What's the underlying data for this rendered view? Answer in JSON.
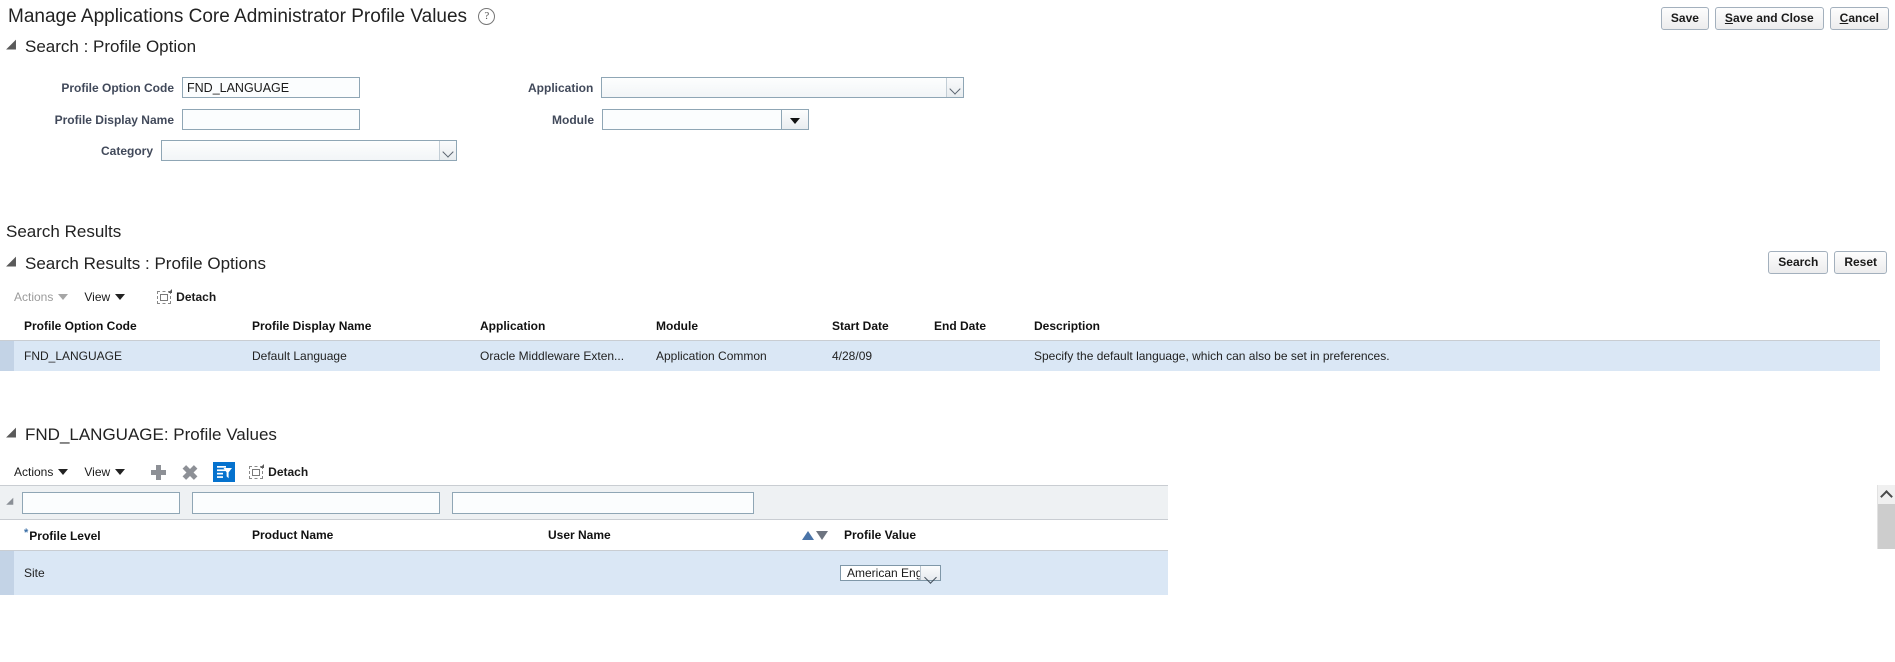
{
  "page": {
    "title": "Manage Applications Core Administrator Profile Values",
    "help_icon": "help-icon"
  },
  "header_buttons": {
    "save": "Save",
    "save_and_close_pre": "S",
    "save_and_close_rest": "ave and Close",
    "cancel_pre": "C",
    "cancel_rest": "ancel"
  },
  "search_section": {
    "title": "Search : Profile Option",
    "fields": {
      "profile_option_code": {
        "label": "Profile Option Code",
        "value": "FND_LANGUAGE"
      },
      "profile_display_name": {
        "label": "Profile Display Name",
        "value": ""
      },
      "category": {
        "label": "Category",
        "value": ""
      },
      "application": {
        "label": "Application",
        "value": ""
      },
      "module": {
        "label": "Module",
        "value": ""
      }
    },
    "buttons": {
      "search": "Search",
      "reset": "Reset"
    }
  },
  "search_results": {
    "plain_heading": "Search Results",
    "section_title": "Search Results : Profile Options",
    "toolbar": {
      "actions": "Actions",
      "view": "View",
      "detach": "Detach"
    },
    "columns": [
      "Profile Option Code",
      "Profile Display Name",
      "Application",
      "Module",
      "Start Date",
      "End Date",
      "Description"
    ],
    "rows": [
      {
        "profile_option_code": "FND_LANGUAGE",
        "profile_display_name": "Default Language",
        "application": "Oracle Middleware Exten...",
        "module": "Application Common",
        "start_date": "4/28/09",
        "end_date": "",
        "description": "Specify the default language, which can also be set in preferences."
      }
    ]
  },
  "profile_values": {
    "section_title": "FND_LANGUAGE: Profile Values",
    "toolbar": {
      "actions": "Actions",
      "view": "View",
      "add": "add-row-icon",
      "delete": "delete-row-icon",
      "query_by_example": "query-by-example-icon",
      "detach": "Detach"
    },
    "filter_row": {
      "profile_level_filter": "",
      "product_name_filter": "",
      "user_name_filter": ""
    },
    "columns": [
      {
        "label": "Profile Level",
        "required": true
      },
      {
        "label": "Product Name",
        "required": false
      },
      {
        "label": "User Name",
        "required": false
      },
      {
        "label": "Profile Value",
        "required": false
      }
    ],
    "rows": [
      {
        "profile_level": "Site",
        "product_name": "",
        "user_name": "",
        "profile_value": "American English"
      }
    ]
  },
  "colors": {
    "accent_blue": "#0572ce",
    "row_selected": "#dae7f5",
    "sort_active": "#4a74a8"
  }
}
